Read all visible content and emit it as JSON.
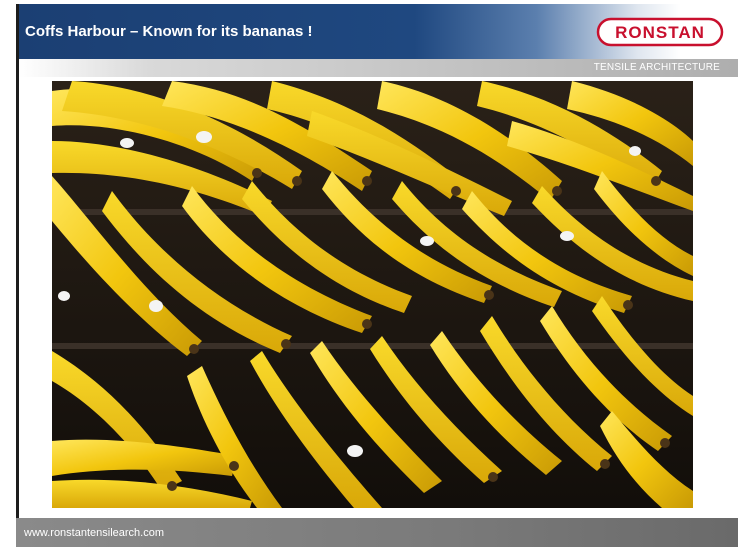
{
  "slide": {
    "title": "Coffs Harbour – Known for its bananas !",
    "logo_text": "RONSTAN",
    "subtitle": "TENSILE ARCHITECTURE",
    "footer": "www.ronstantensilearch.com",
    "photo_icon": "bananas-photo"
  },
  "colors": {
    "header_blue": "#1f4880",
    "logo_red": "#c8102e",
    "footer_grey": "#7a7a7a",
    "banana_yellow": "#f2c60e"
  }
}
